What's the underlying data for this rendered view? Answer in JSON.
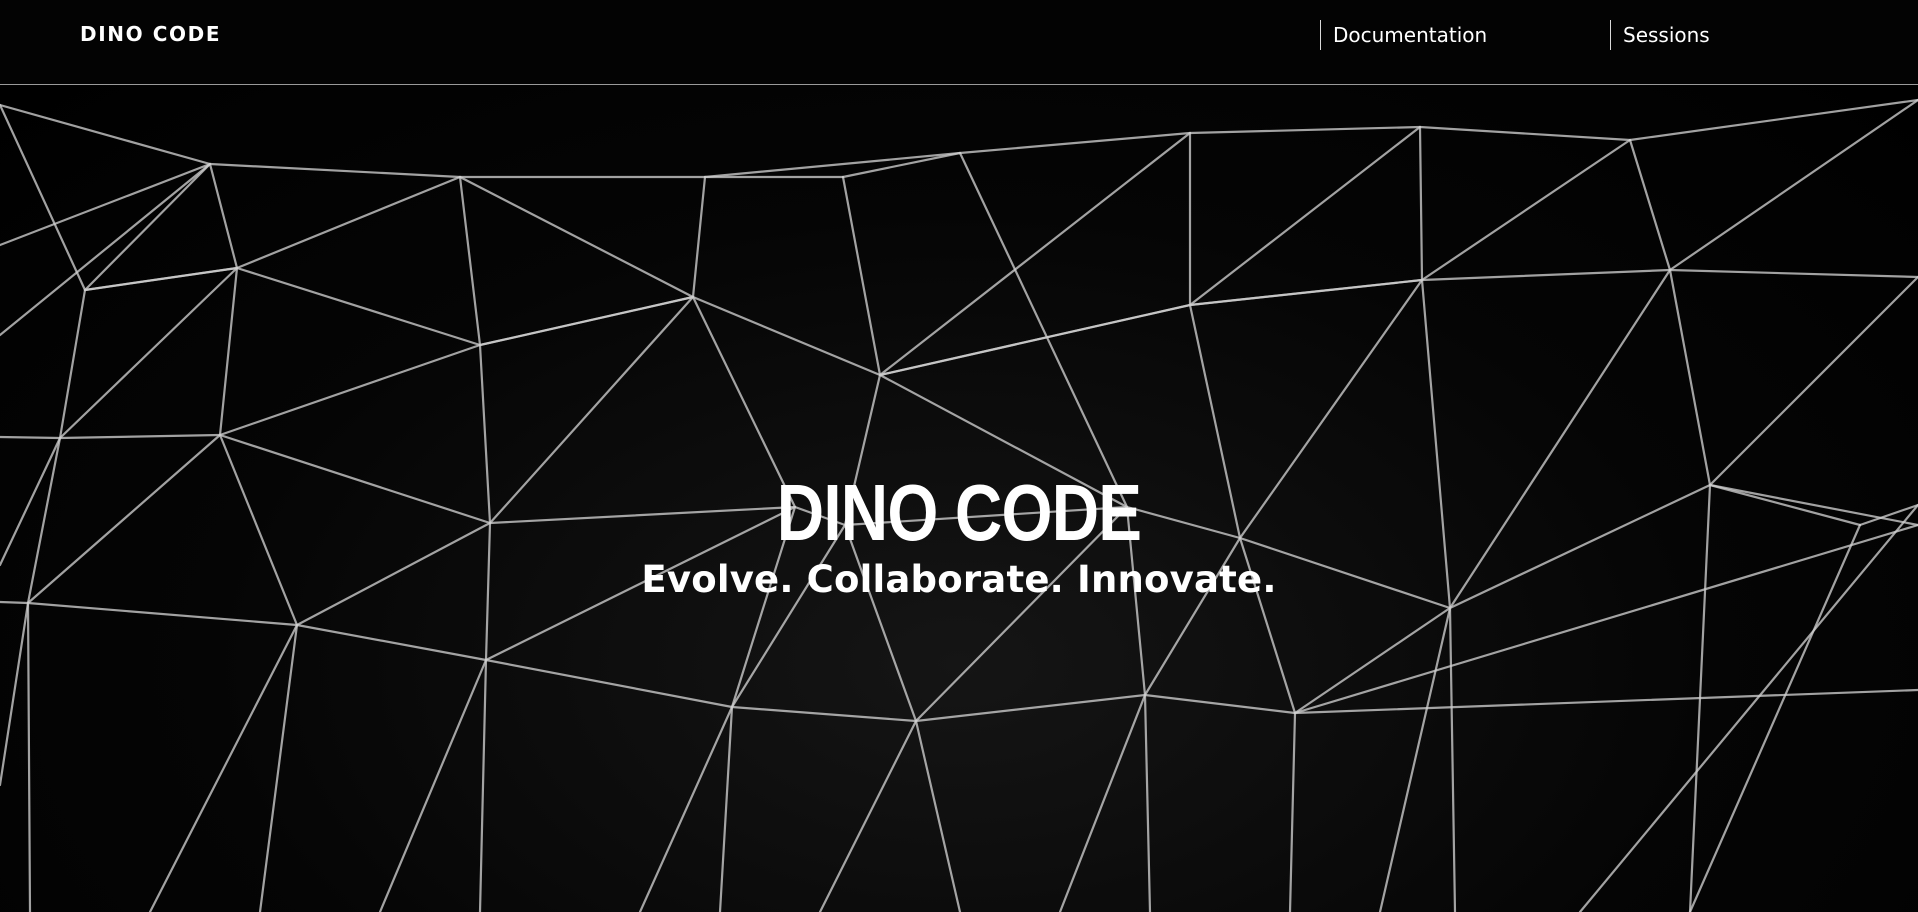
{
  "header": {
    "logo": "DINO CODE",
    "nav": [
      {
        "label": "Documentation"
      },
      {
        "label": "Sessions"
      }
    ]
  },
  "hero": {
    "title": "DINO CODE",
    "tagline": "Evolve. Collaborate. Innovate."
  },
  "colors": {
    "background": "#000000",
    "text": "#ffffff",
    "mesh_line": "#cfcfcf",
    "header_divider": "#9a9a9a"
  }
}
